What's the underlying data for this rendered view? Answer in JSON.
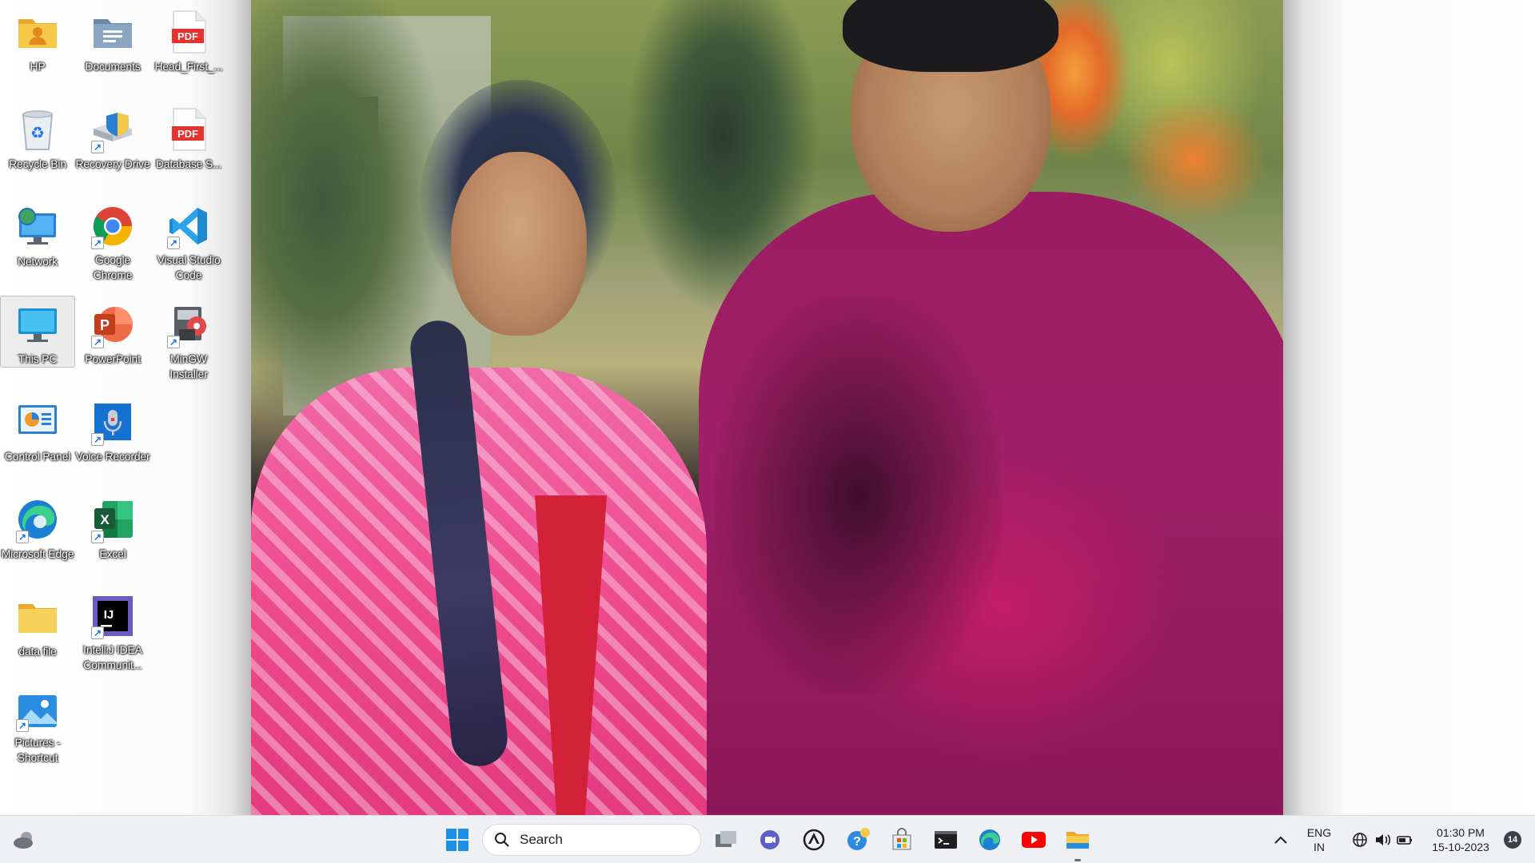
{
  "desktop": {
    "icons": [
      {
        "label": "HP",
        "icon": "user-folder-icon"
      },
      {
        "label": "Documents",
        "icon": "documents-icon"
      },
      {
        "label": "Head_First_...",
        "icon": "pdf-file-icon",
        "badge": "PDF"
      },
      {
        "label": "Recycle Bin",
        "icon": "recycle-bin-icon"
      },
      {
        "label": "Recovery Drive",
        "icon": "recovery-drive-icon"
      },
      {
        "label": "Database S...",
        "icon": "pdf-file-icon",
        "badge": "PDF"
      },
      {
        "label": "Network",
        "icon": "network-icon"
      },
      {
        "label": "Google Chrome",
        "icon": "chrome-icon"
      },
      {
        "label": "Visual Studio Code",
        "icon": "vscode-icon"
      },
      {
        "label": "This PC",
        "icon": "this-pc-icon"
      },
      {
        "label": "PowerPoint",
        "icon": "powerpoint-icon",
        "badge": "P"
      },
      {
        "label": "MinGW Installer",
        "icon": "mingw-installer-icon"
      },
      {
        "label": "Control Panel",
        "icon": "control-panel-icon"
      },
      {
        "label": "Voice Recorder",
        "icon": "voice-recorder-icon"
      },
      {
        "label": "Microsoft Edge",
        "icon": "edge-icon"
      },
      {
        "label": "Excel",
        "icon": "excel-icon",
        "badge": "X"
      },
      {
        "label": "data file",
        "icon": "folder-icon"
      },
      {
        "label": "IntelliJ IDEA Communit...",
        "icon": "intellij-icon",
        "badge": "IJ"
      },
      {
        "label": "Pictures - Shortcut",
        "icon": "pictures-shortcut-icon"
      }
    ],
    "colors": {
      "folder": "#f7c948",
      "pdf": "#e5322d",
      "vscode": "#1f8ad2",
      "powerpoint": "#d35230",
      "excel": "#1d7a45",
      "intellij": "#000000",
      "edge": "#1faa8c"
    }
  },
  "taskbar": {
    "search_placeholder": "Search",
    "apps": [
      {
        "name": "weather-widget-icon"
      },
      {
        "name": "start-button-icon"
      },
      {
        "name": "task-view-icon"
      },
      {
        "name": "teams-chat-icon"
      },
      {
        "name": "app-icon"
      },
      {
        "name": "get-help-icon"
      },
      {
        "name": "microsoft-store-icon"
      },
      {
        "name": "terminal-icon"
      },
      {
        "name": "edge-icon"
      },
      {
        "name": "youtube-icon"
      },
      {
        "name": "file-explorer-icon"
      }
    ],
    "tray": {
      "language_primary": "ENG",
      "language_secondary": "IN",
      "time": "01:30 PM",
      "date": "15-10-2023",
      "notification_count": "14"
    }
  }
}
